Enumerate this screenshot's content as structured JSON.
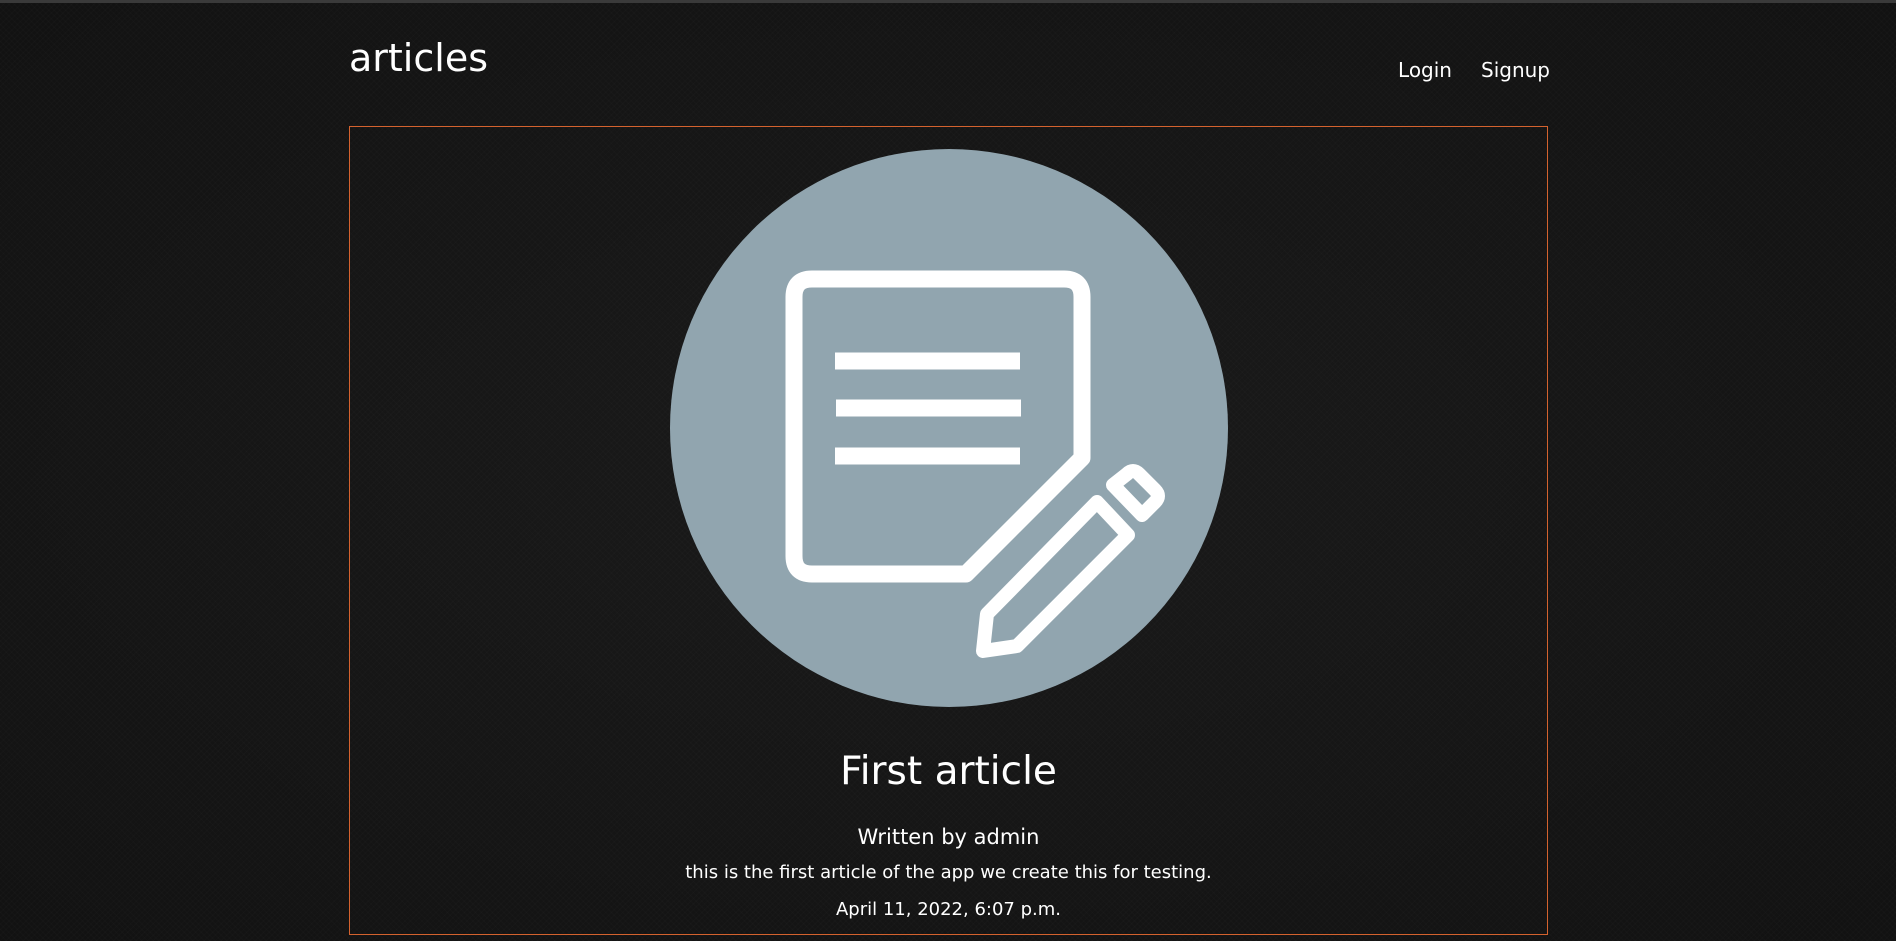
{
  "header": {
    "logo": "articles",
    "nav": {
      "login": "Login",
      "signup": "Signup"
    }
  },
  "article": {
    "thumbnail_icon": "document-pencil-icon",
    "thumbnail_bg": "#91a5af",
    "title": "First article",
    "author_line": "Written by admin",
    "body": "this is the first article of the app we create this for testing.",
    "date": "April 11, 2022, 6:07 p.m."
  },
  "colors": {
    "background": "#141414",
    "card_border": "#d4622e",
    "text": "#ffffff"
  }
}
